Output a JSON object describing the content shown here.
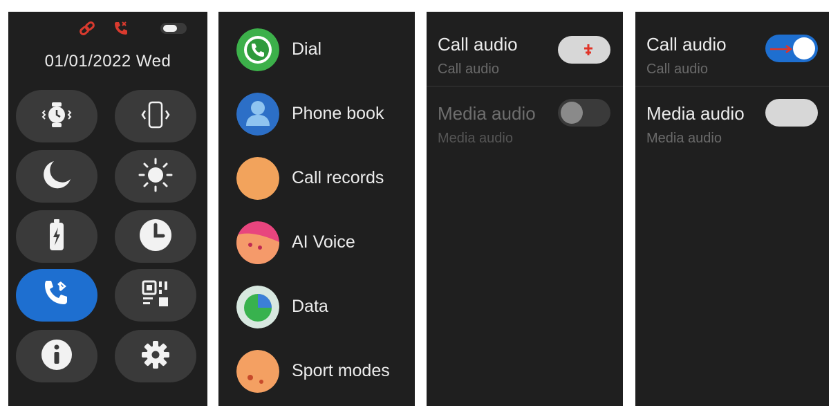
{
  "quick_panel": {
    "date": "01/01/2022 Wed",
    "colors": {
      "accent": "#1e6fd0",
      "alert": "#d93a2e"
    }
  },
  "app_menu": {
    "items": [
      {
        "label": "Dial",
        "icon": "dial-icon"
      },
      {
        "label": "Phone book",
        "icon": "phone-book-icon"
      },
      {
        "label": "Call records",
        "icon": "call-records-icon"
      },
      {
        "label": "AI Voice",
        "icon": "ai-voice-icon"
      },
      {
        "label": "Data",
        "icon": "data-icon"
      },
      {
        "label": "Sport modes",
        "icon": "sport-modes-icon"
      }
    ]
  },
  "audio_off": {
    "call_audio": {
      "title": "Call audio",
      "subtitle": "Call audio",
      "state": "off"
    },
    "media_audio": {
      "title": "Media audio",
      "subtitle": "Media audio",
      "state": "disabled"
    }
  },
  "audio_on": {
    "call_audio": {
      "title": "Call audio",
      "subtitle": "Call audio",
      "state": "on"
    },
    "media_audio": {
      "title": "Media audio",
      "subtitle": "Media audio",
      "state": "off"
    }
  }
}
